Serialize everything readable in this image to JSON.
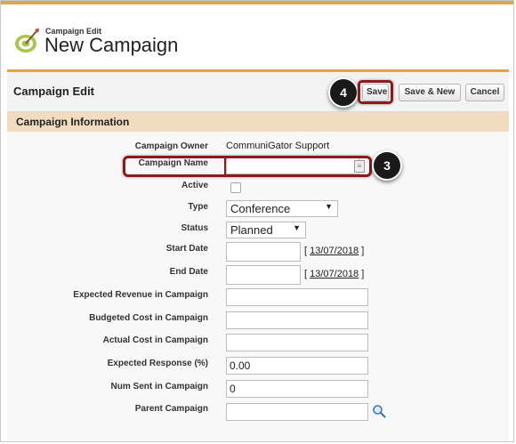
{
  "header": {
    "subtitle": "Campaign Edit",
    "title": "New Campaign",
    "icon": "campaign-target-icon"
  },
  "detail": {
    "title": "Campaign Edit",
    "buttons": {
      "save": "Save",
      "save_new": "Save & New",
      "cancel": "Cancel"
    },
    "annotations": {
      "save_step": "4",
      "name_step": "3"
    },
    "section_title": "Campaign Information"
  },
  "fields": {
    "owner": {
      "label": "Campaign Owner",
      "value": "CommuniGator Support"
    },
    "name": {
      "label": "Campaign Name",
      "value": ""
    },
    "active": {
      "label": "Active",
      "checked": false
    },
    "type": {
      "label": "Type",
      "value": "Conference"
    },
    "status": {
      "label": "Status",
      "value": "Planned"
    },
    "start_date": {
      "label": "Start Date",
      "value": "",
      "today": "13/07/2018"
    },
    "end_date": {
      "label": "End Date",
      "value": "",
      "today": "13/07/2018"
    },
    "expected_revenue": {
      "label": "Expected Revenue in Campaign",
      "value": ""
    },
    "budgeted_cost": {
      "label": "Budgeted Cost in Campaign",
      "value": ""
    },
    "actual_cost": {
      "label": "Actual Cost in Campaign",
      "value": ""
    },
    "expected_response": {
      "label": "Expected Response (%)",
      "value": "0.00"
    },
    "num_sent": {
      "label": "Num Sent in Campaign",
      "value": "0"
    },
    "parent": {
      "label": "Parent Campaign",
      "value": ""
    }
  },
  "colors": {
    "accent": "#e3a34a",
    "section": "#f2dcc0",
    "highlight": "#8b1a1a"
  }
}
